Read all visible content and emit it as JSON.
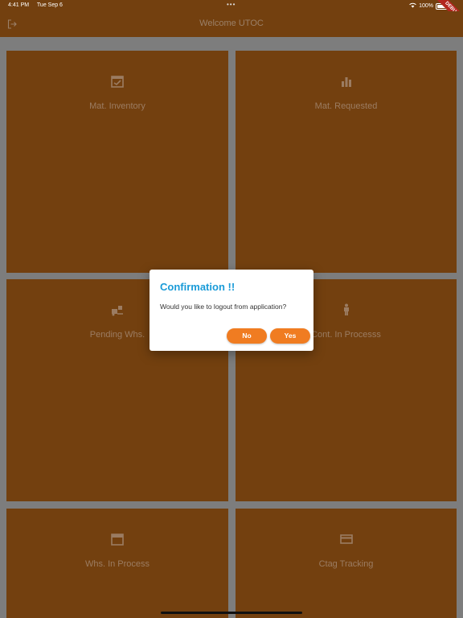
{
  "status_bar": {
    "time": "4:41 PM",
    "date": "Tue Sep 6",
    "battery": "100%"
  },
  "debug_banner": "DEBUG",
  "app_bar": {
    "title": "Welcome UTOC"
  },
  "tiles": [
    {
      "label": "Mat. Inventory",
      "icon": "inventory-icon"
    },
    {
      "label": "Mat. Requested",
      "icon": "bar-chart-icon"
    },
    {
      "label": "Pending Whs.",
      "icon": "forklift-icon"
    },
    {
      "label": "Cont. In Processs",
      "icon": "person-cargo-icon"
    },
    {
      "label": "Whs. In Process",
      "icon": "calendar-icon"
    },
    {
      "label": "Ctag Tracking",
      "icon": "card-icon"
    }
  ],
  "dialog": {
    "title": "Confirmation !!",
    "message": "Would you like to logout from application?",
    "no_label": "No",
    "yes_label": "Yes"
  },
  "colors": {
    "app_bar": "#73400f",
    "tile": "#73400f",
    "dialog_title": "#1a9bd8",
    "button": "#f07c21"
  }
}
